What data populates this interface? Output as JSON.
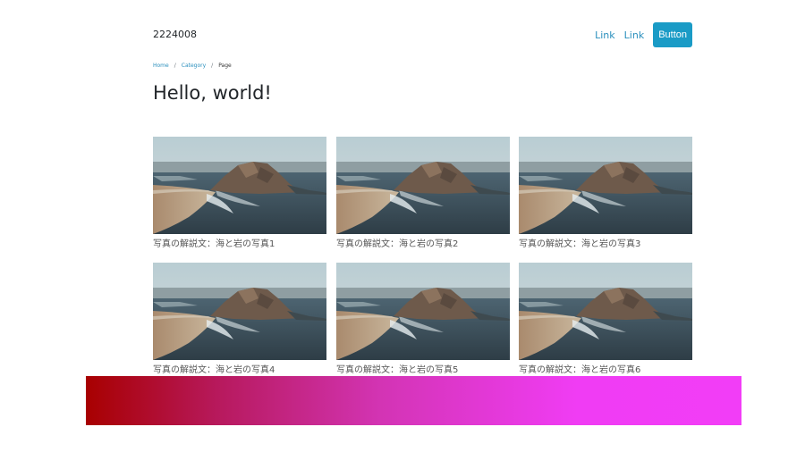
{
  "header": {
    "brand": "2224008",
    "nav_links": [
      "Link",
      "Link"
    ],
    "button_label": "Button"
  },
  "breadcrumb": {
    "items": [
      "Home",
      "Category"
    ],
    "separator": "/",
    "current": "Page"
  },
  "page_title": "Hello, world!",
  "gallery": {
    "items": [
      {
        "caption": "写真の解説文：海と岩の写真1"
      },
      {
        "caption": "写真の解説文：海と岩の写真2"
      },
      {
        "caption": "写真の解説文：海と岩の写真3"
      },
      {
        "caption": "写真の解説文：海と岩の写真4"
      },
      {
        "caption": "写真の解説文：海と岩の写真5"
      },
      {
        "caption": "写真の解説文：海と岩の写真6"
      }
    ]
  },
  "colors": {
    "accent": "#1a9bc6",
    "link": "#2a8fbd",
    "gradient_start": "#a80000",
    "gradient_end": "#f23df7"
  }
}
